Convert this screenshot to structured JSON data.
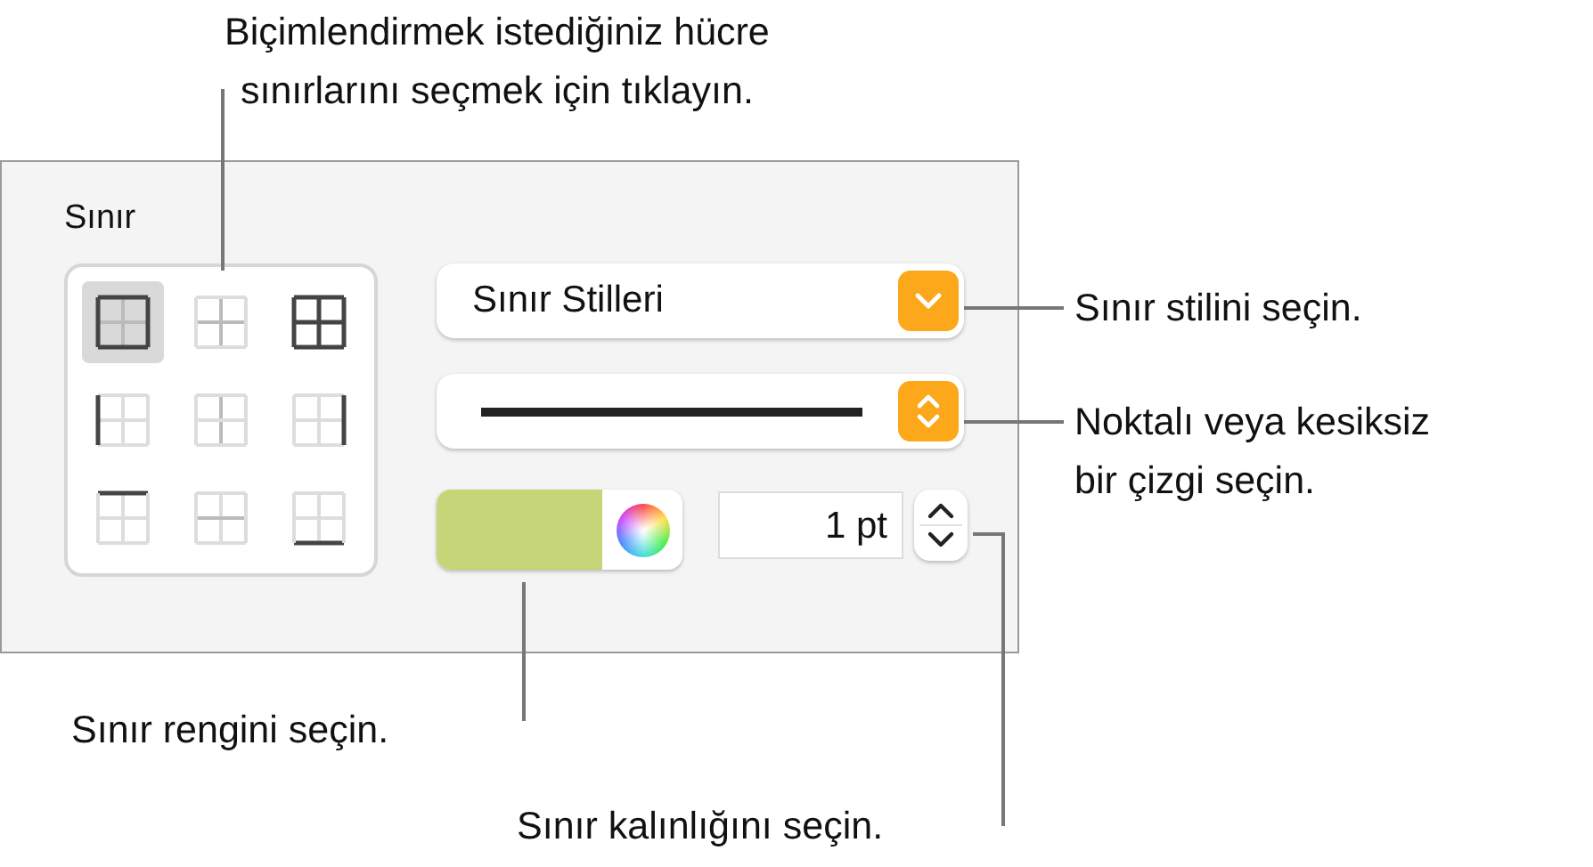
{
  "panel": {
    "title": "Sınır",
    "border_presets": [
      {
        "kind": "outer",
        "selected": true
      },
      {
        "kind": "inner",
        "selected": false
      },
      {
        "kind": "all",
        "selected": false
      },
      {
        "kind": "left",
        "selected": false
      },
      {
        "kind": "inner-vertical",
        "selected": false
      },
      {
        "kind": "right",
        "selected": false
      },
      {
        "kind": "top",
        "selected": false
      },
      {
        "kind": "inner-horizontal",
        "selected": false
      },
      {
        "kind": "bottom",
        "selected": false
      }
    ],
    "style_popup": {
      "value": "Sınır Stilleri"
    },
    "line_popup": {
      "kind": "solid"
    },
    "color_well": {
      "color": "#c6d577"
    },
    "width_field": {
      "value": "1 pt"
    }
  },
  "callouts": [
    {
      "lines": [
        "Biçimlendirmek istediğiniz hücre",
        "sınırlarını seçmek için tıklayın."
      ]
    },
    {
      "lines": [
        "Sınır stilini seçin."
      ]
    },
    {
      "lines": [
        "Noktalı veya kesiksiz",
        "bir çizgi seçin."
      ]
    },
    {
      "lines": [
        "Sınır rengini seçin."
      ]
    },
    {
      "lines": [
        "Sınır kalınlığını seçin."
      ]
    }
  ]
}
